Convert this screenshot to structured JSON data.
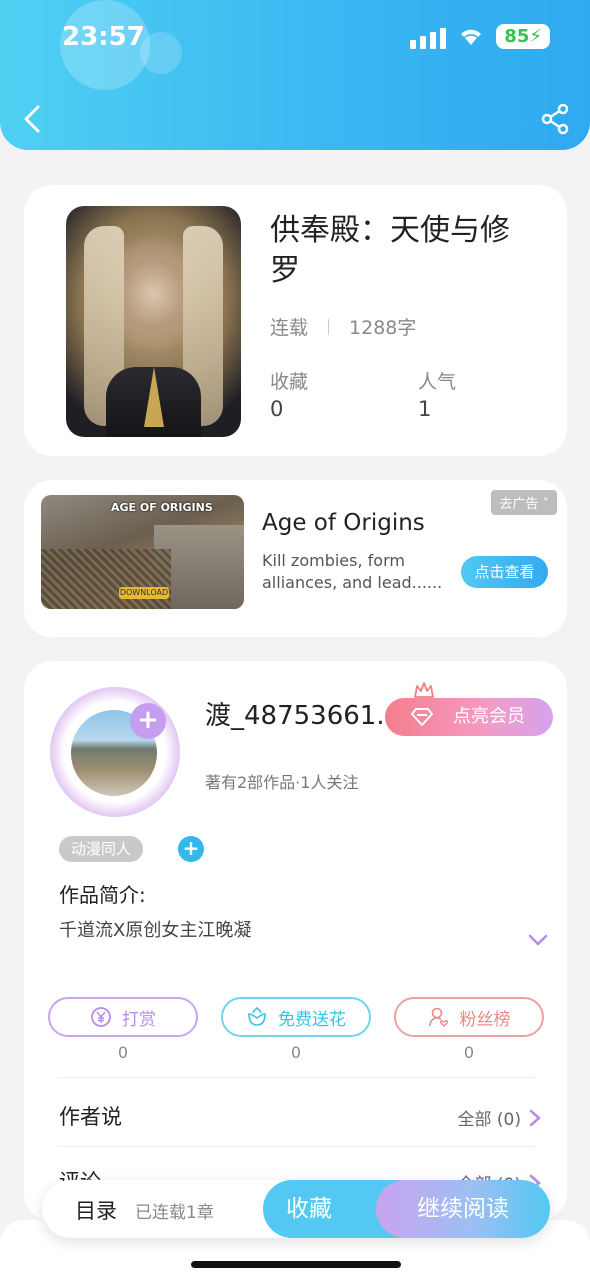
{
  "status_bar": {
    "time": "23:57",
    "battery": "85"
  },
  "book": {
    "title": "供奉殿：天使与修罗",
    "status": "连载",
    "word_count": "1288字",
    "stats": [
      {
        "label": "收藏",
        "value": "0"
      },
      {
        "label": "人气",
        "value": "1"
      }
    ]
  },
  "ad": {
    "tag": "去广告 ˅",
    "title": "Age of Origins",
    "description": "Kill zombies, form alliances, and lead......",
    "button": "点击查看",
    "image_logo": "AGE OF ORIGINS",
    "image_button": "DOWNLOAD"
  },
  "author": {
    "name": "渡_48753661...",
    "vip_button": "点亮会员",
    "subtitle": "著有2部作品·1人关注",
    "tag": "动漫同人",
    "intro_label": "作品简介:",
    "intro_text": "千道流X原创女主江晚凝"
  },
  "actions": [
    {
      "label": "打赏",
      "count": "0",
      "icon": "yen-coin-icon",
      "color": "#b98be6"
    },
    {
      "label": "免费送花",
      "count": "0",
      "icon": "flower-icon",
      "color": "#38c3e6"
    },
    {
      "label": "粉丝榜",
      "count": "0",
      "icon": "fan-user-icon",
      "color": "#e98a8a"
    }
  ],
  "sections": [
    {
      "label": "作者说",
      "right": "全部 (0)"
    },
    {
      "label": "评论",
      "right": "全部 (0)"
    }
  ],
  "bottom_bar": {
    "toc": "目录",
    "chapters": "已连载1章",
    "favorite": "收藏",
    "continue": "继续阅读"
  },
  "colors": {
    "header": "#3ab8f2",
    "accent": "#52c8f2",
    "vip": "#f57e8c"
  }
}
